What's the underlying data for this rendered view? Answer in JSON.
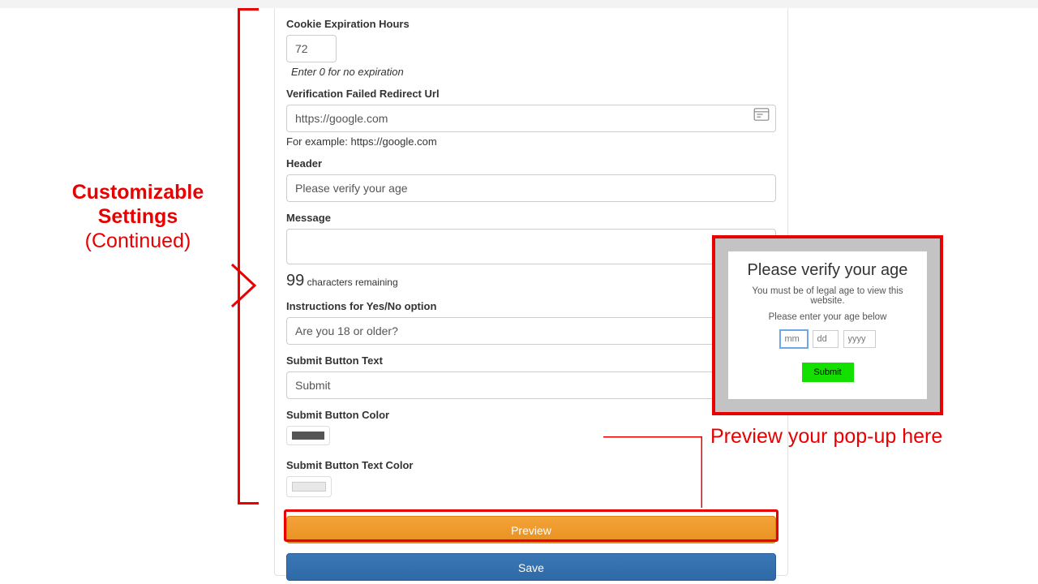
{
  "form": {
    "cookie_label": "Cookie Expiration Hours",
    "cookie_value": "72",
    "cookie_hint": "Enter 0 for no expiration",
    "redirect_label": "Verification Failed Redirect Url",
    "redirect_value": "https://google.com",
    "redirect_hint": "For example: https://google.com",
    "header_label": "Header",
    "header_value": "Please verify your age",
    "message_label": "Message",
    "message_value": "",
    "chars_number": "99",
    "chars_text": "characters remaining",
    "instructions_label": "Instructions for Yes/No option",
    "instructions_value": "Are you 18 or older?",
    "submit_text_label": "Submit Button Text",
    "submit_text_value": "Submit",
    "submit_color_label": "Submit Button Color",
    "submit_color_value": "#555555",
    "submit_textcolor_label": "Submit Button Text Color",
    "submit_textcolor_value": "#e8e8e8",
    "preview_btn": "Preview",
    "save_btn": "Save"
  },
  "annotations": {
    "left_title_1": "Customizable",
    "left_title_2": "Settings",
    "left_sub": "(Continued)",
    "preview_caption": "Preview your pop-up here"
  },
  "popup": {
    "title": "Please verify your age",
    "message": "You must be of legal age to view this website.",
    "instruction": "Please enter your age below",
    "mm": "mm",
    "dd": "dd",
    "yyyy": "yyyy",
    "submit": "Submit"
  }
}
